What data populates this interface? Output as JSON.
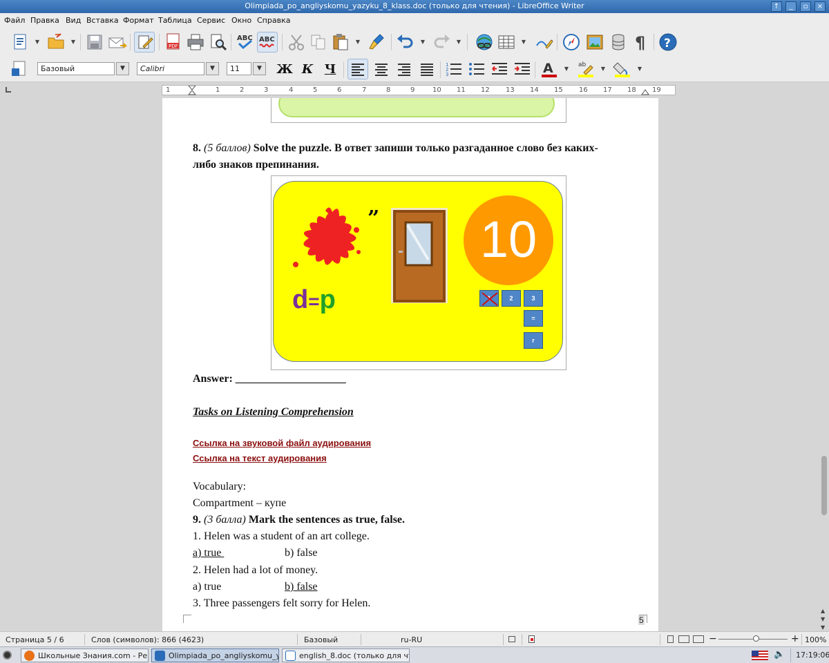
{
  "window": {
    "title": "Olimpiada_po_angliyskomu_yazyku_8_klass.doc (только для чтения) - LibreOffice Writer"
  },
  "menu": [
    "Файл",
    "Правка",
    "Вид",
    "Вставка",
    "Формат",
    "Таблица",
    "Сервис",
    "Окно",
    "Справка"
  ],
  "toolbar": {
    "style_value": "Базовый",
    "font_value": "Calibri",
    "size_value": "11",
    "bold": "Ж",
    "italic": "К",
    "underline": "Ч"
  },
  "ruler": {
    "numbers": [
      "1",
      "1",
      "2",
      "3",
      "4",
      "5",
      "6",
      "7",
      "8",
      "9",
      "10",
      "11",
      "12",
      "13",
      "14",
      "15",
      "16",
      "17",
      "18",
      "19"
    ]
  },
  "document": {
    "q8_num": "8.",
    "q8_points": "(5 баллов)",
    "q8_text_line1": "Solve the puzzle. В ответ запиши только разгаданное слово без каких-",
    "q8_text_line2": "либо знаков препинания.",
    "puzzle": {
      "quote": "”",
      "big_number": "10",
      "letter_d": "d",
      "equals": "=",
      "letter_p": "p",
      "box1": "1",
      "box2": "2",
      "box3": "3",
      "box4": "=",
      "box5": "r"
    },
    "answer_label": "Answer:",
    "answer_line": "____________________",
    "listening_title": "Tasks on Listening Comprehension",
    "link1": "Ссылка на звуковой файл аудирования",
    "link2": "Ссылка на текст аудирования",
    "vocab_label": "Vocabulary:",
    "vocab_item": "Compartment – купе",
    "q9_num": "9.",
    "q9_points": "(3 балла)",
    "q9_text": "Mark the sentences as true, false.",
    "s1": "1. Helen was a student of an art college.",
    "s1_a": "a) true ",
    "s1_b": "b) false",
    "s2": "2. Helen had a lot of money.",
    "s2_a": "a) true",
    "s2_b": "b) false",
    "s3": "3. Three passengers felt sorry for Helen.",
    "page_number": "5"
  },
  "status": {
    "page": "Страница 5 / 6",
    "words": "Слов (символов): 866 (4623)",
    "style": "Базовый",
    "lang": "ru-RU",
    "zoom": "100%"
  },
  "taskbar": {
    "tasks": [
      "Школьные Знания.com - Ре...",
      "Olimpiada_po_angliyskomu_y...",
      "english_8.doc (только для чт..."
    ],
    "clock": "17:19:06"
  },
  "colors": {
    "accent": "#2f69ad",
    "link": "#8b0f0f",
    "puzzle_bg": "#ffff00",
    "circle": "#ff9900",
    "box": "#4f86c7"
  }
}
